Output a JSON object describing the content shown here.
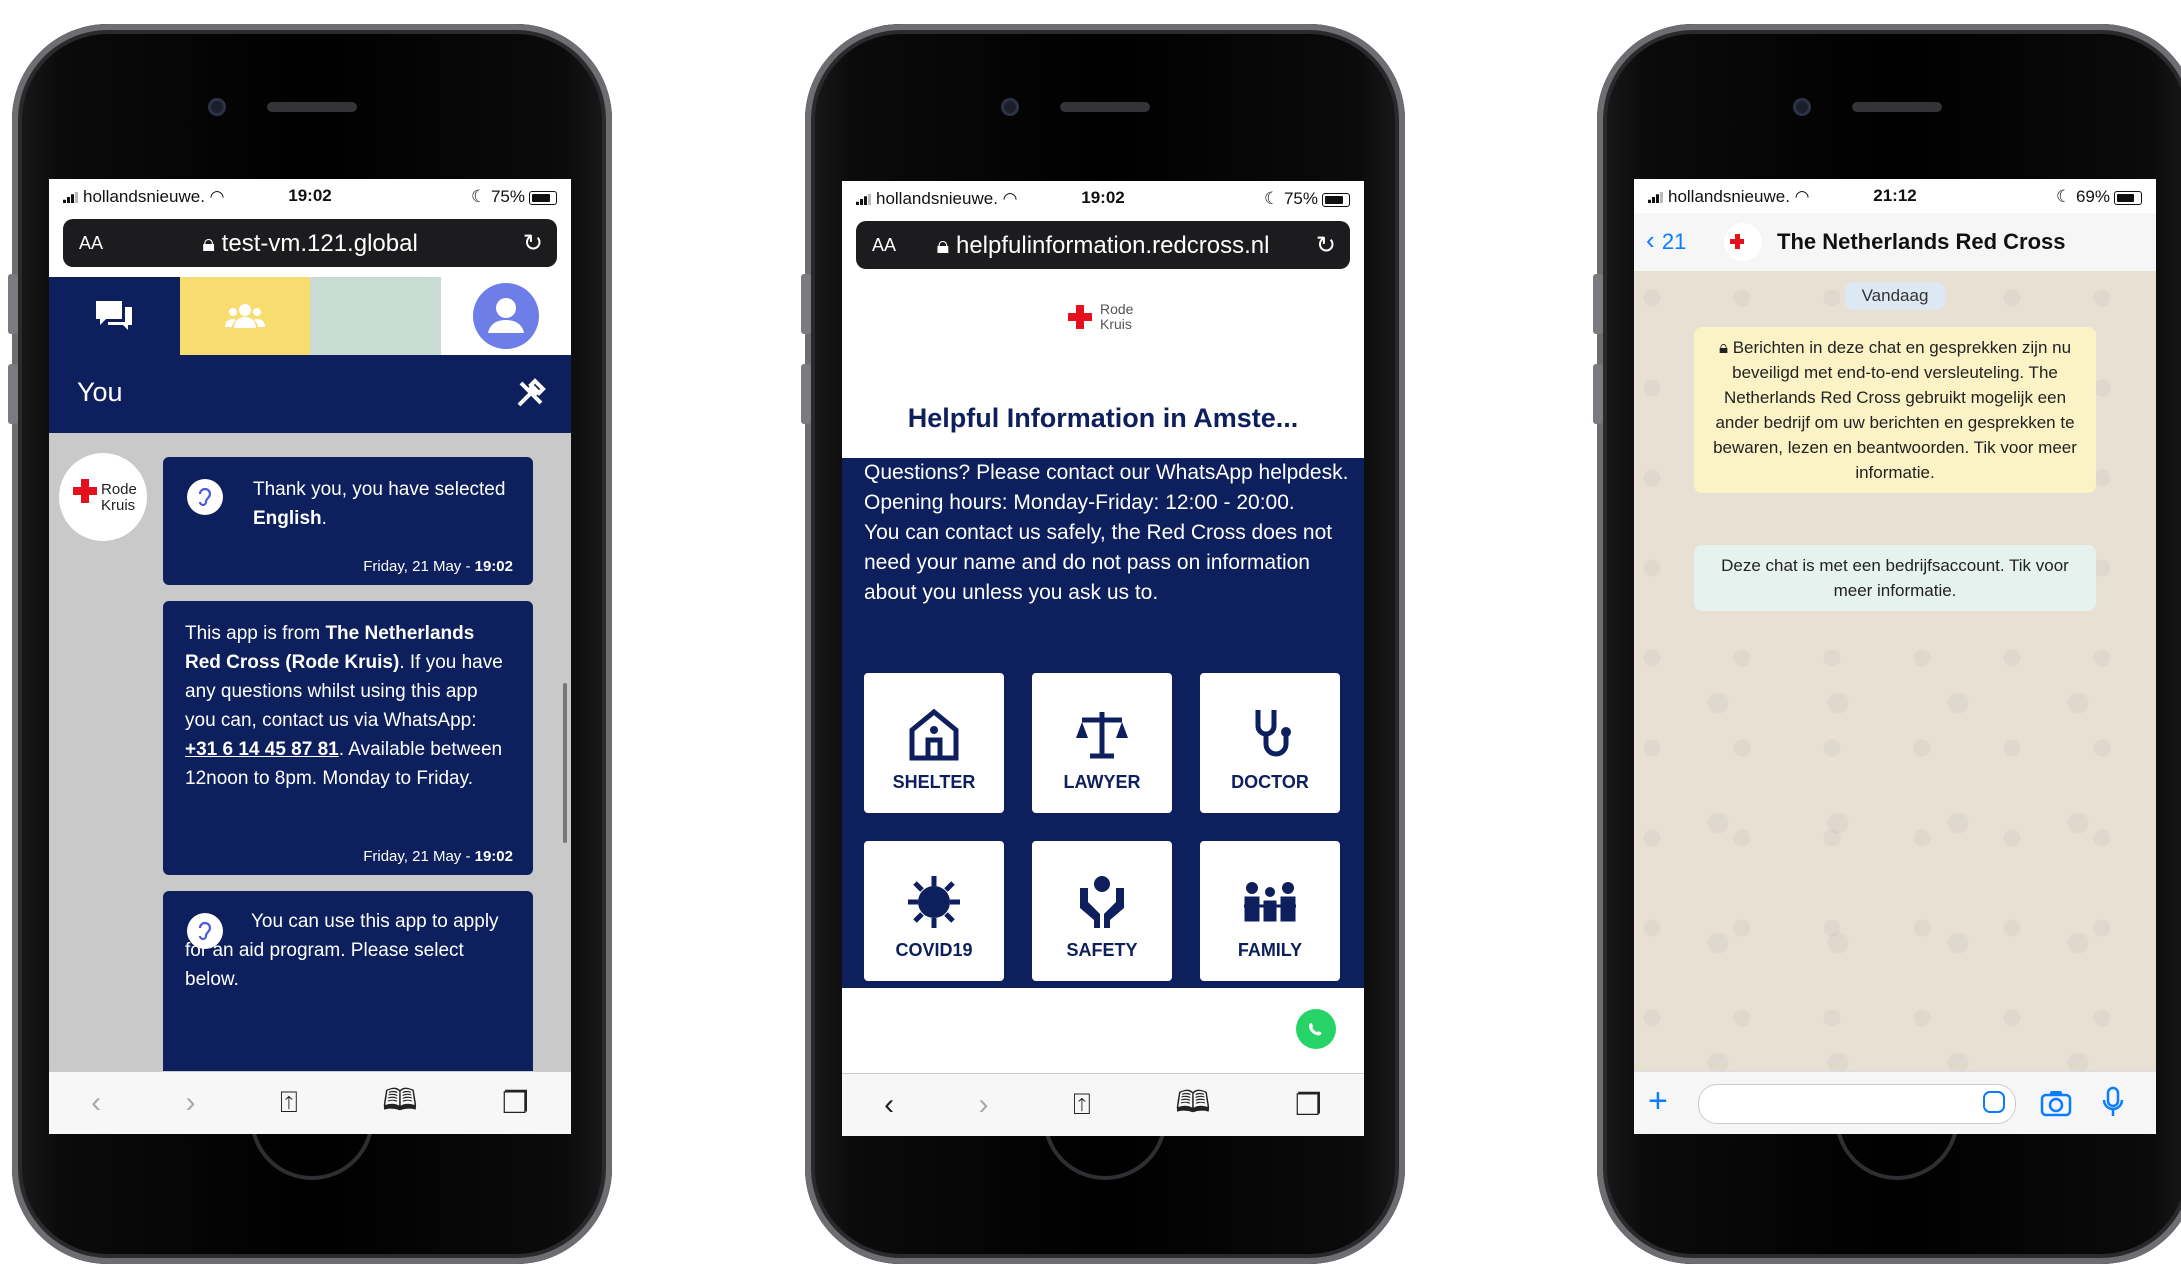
{
  "phone1": {
    "status": {
      "carrier": "hollandsnieuwe.",
      "time": "19:02",
      "battery": "75%"
    },
    "url_bar": {
      "aa": "AA",
      "url": "test-vm.121.global"
    },
    "header_title": "You",
    "avatar_logo": {
      "line1": "Rode",
      "line2": "Kruis"
    },
    "messages": [
      {
        "pre": "Thank you, you have selected ",
        "bold": "English",
        "post": ".",
        "time": "Friday, 21 May - ",
        "time_bold": "19:02"
      },
      {
        "p1": "This app is from ",
        "b1": "The Netherlands Red Cross (Rode Kruis)",
        "p2": ". If you have any questions whilst using this app you can, contact us via WhatsApp: ",
        "link": "+31 6 14 45 87 81",
        "p3": ". Available between 12noon to 8pm. Monday to Friday.",
        "time": "Friday, 21 May - ",
        "time_bold": "19:02"
      },
      {
        "text": "You can use this app to apply for an aid program. Please select below."
      }
    ]
  },
  "phone2": {
    "status": {
      "carrier": "hollandsnieuwe.",
      "time": "19:02",
      "battery": "75%"
    },
    "url_bar": {
      "aa": "AA",
      "url": "helpfulinformation.redcross.nl"
    },
    "logo": {
      "line1": "Rode",
      "line2": "Kruis"
    },
    "title": "Helpful Information in Amste...",
    "intro_1": "Questions? Please contact our WhatsApp helpdesk. Opening hours: Monday-Friday: 12:00 - 20:00.",
    "intro_2": "You can contact us safely, the Red Cross does not need your name and do not pass on information about you unless you ask us to.",
    "tiles": [
      "SHELTER",
      "LAWYER",
      "DOCTOR",
      "COVID19",
      "SAFETY",
      "FAMILY"
    ]
  },
  "phone3": {
    "status": {
      "carrier": "hollandsnieuwe.",
      "time": "21:12",
      "battery": "69%"
    },
    "back_count": "21",
    "contact_name": "The Netherlands Red Cross",
    "date_chip": "Vandaag",
    "encryption_notice": "Berichten in deze chat en gesprekken zijn nu beveiligd met end-to-end versleuteling. The Netherlands Red Cross gebruikt mogelijk een ander bedrijf om uw berichten en gesprekken te bewaren, lezen en beantwoorden. Tik voor meer informatie.",
    "business_notice": "Deze chat is met een bedrijfsaccount. Tik voor meer informatie."
  },
  "colors": {
    "navy": "#0d1f5c",
    "yellow": "#f7dc6f",
    "mint": "#c8dcd4",
    "avatar_purple": "#6d7ee8",
    "red": "#e3111b",
    "whatsapp_green": "#25d366",
    "ios_blue": "#0a7cff"
  }
}
